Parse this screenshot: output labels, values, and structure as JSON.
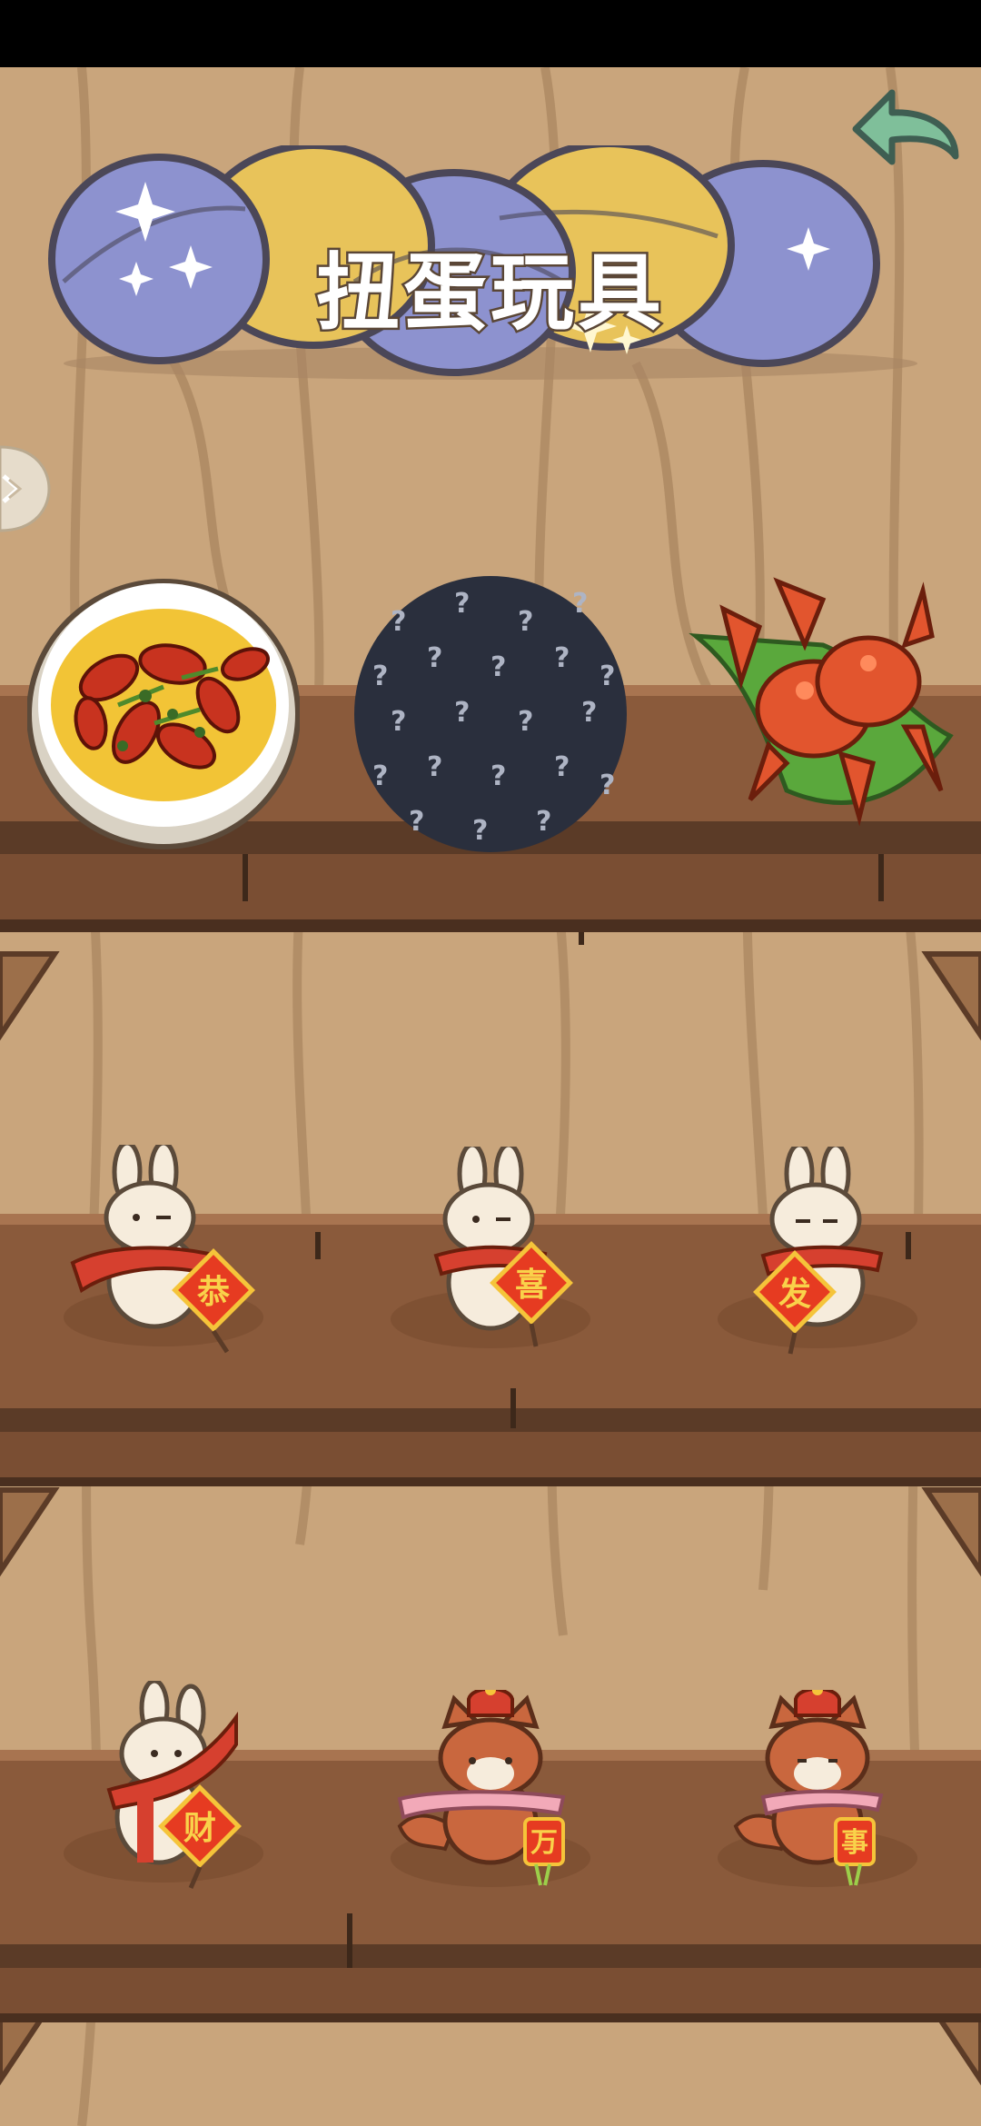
{
  "screen": {
    "title": "扭蛋玩具"
  },
  "colors": {
    "wall": "#c9a57c",
    "plank": "#8a5a3b",
    "plank_shadow": "#5b3b27",
    "capsule_blue": "#8d92cf",
    "capsule_yellow": "#e8c35a",
    "back_arrow": "#7fbf9a"
  },
  "collection": {
    "rows": [
      {
        "slots": [
          {
            "name": "crayfish-dish",
            "unlocked": true
          },
          {
            "name": "locked-mystery-slot",
            "unlocked": false
          },
          {
            "name": "crab-dish",
            "unlocked": true
          }
        ]
      },
      {
        "slots": [
          {
            "name": "bunny-gong",
            "sign": "恭",
            "unlocked": true
          },
          {
            "name": "bunny-xi",
            "sign": "喜",
            "unlocked": true
          },
          {
            "name": "bunny-fa",
            "sign": "发",
            "unlocked": true
          }
        ]
      },
      {
        "slots": [
          {
            "name": "bunny-cai",
            "sign": "财",
            "unlocked": true
          },
          {
            "name": "fox-wan",
            "sign": "万",
            "unlocked": true
          },
          {
            "name": "fox-shi",
            "sign": "事",
            "unlocked": true
          }
        ]
      }
    ]
  },
  "icons": {
    "back": "back-arrow-icon",
    "side_tab": "side-expand-icon",
    "locked": "question-mark-icon"
  }
}
